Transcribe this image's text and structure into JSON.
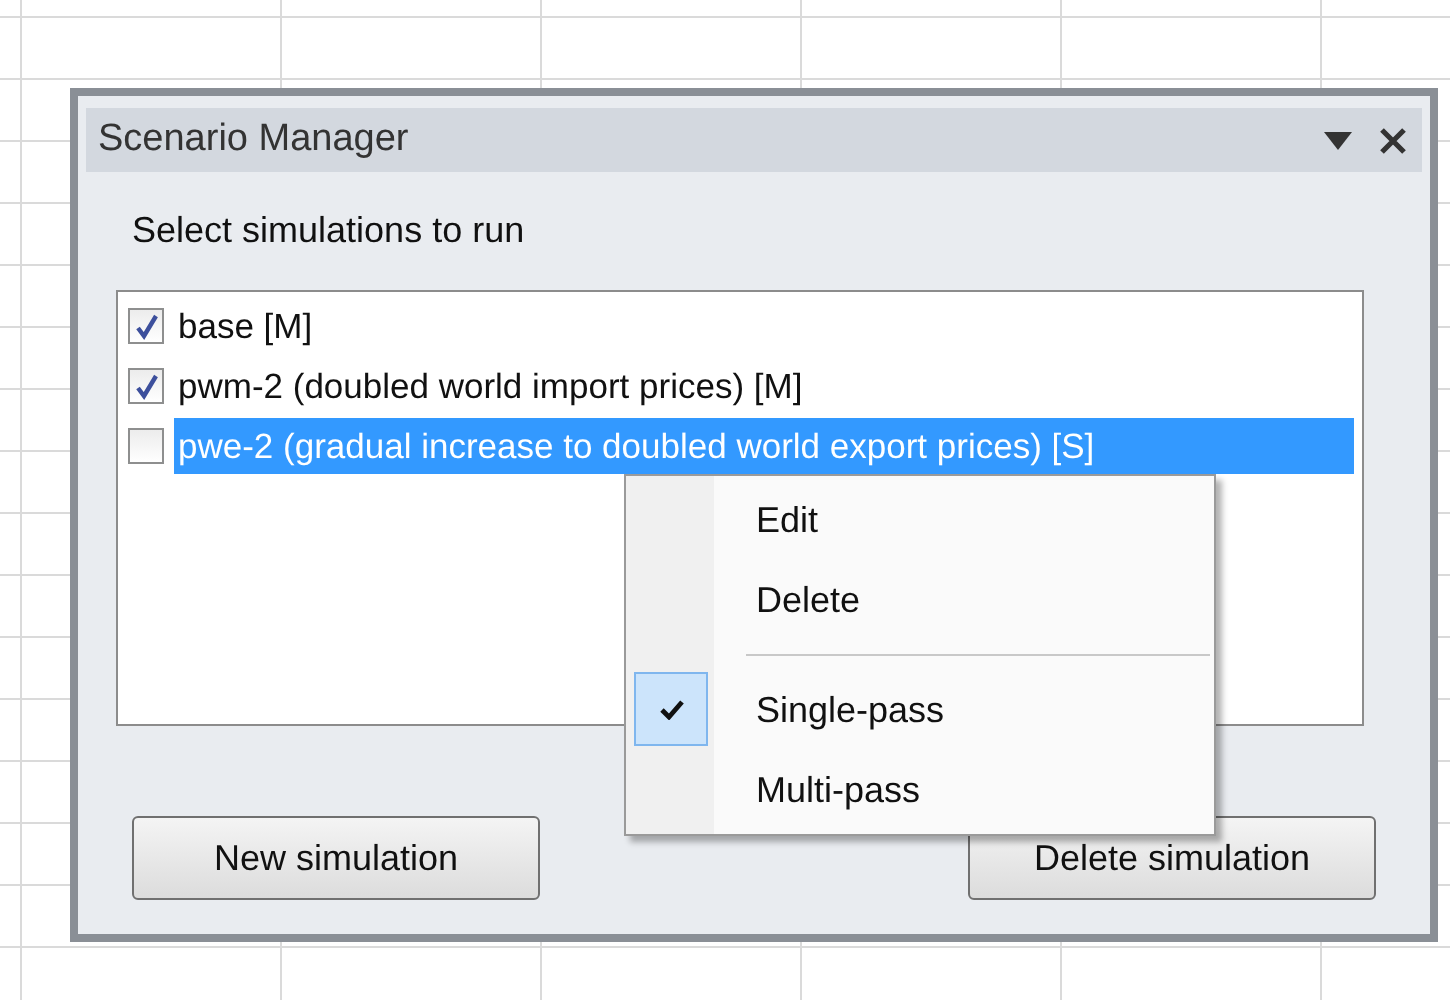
{
  "panel": {
    "title": "Scenario Manager",
    "prompt": "Select simulations to run",
    "simulations": [
      {
        "label": "base [M]",
        "checked": true,
        "selected": false
      },
      {
        "label": "pwm-2 (doubled world import prices) [M]",
        "checked": true,
        "selected": false
      },
      {
        "label": "pwe-2 (gradual increase to doubled world export prices) [S]",
        "checked": false,
        "selected": true
      }
    ],
    "buttons": [
      "New simulation",
      "Delete simulation"
    ]
  },
  "context_menu": {
    "sections": [
      [
        {
          "label": "Edit",
          "checked": false
        },
        {
          "label": "Delete",
          "checked": false
        }
      ],
      [
        {
          "label": "Single-pass",
          "checked": true
        },
        {
          "label": "Multi-pass",
          "checked": false
        }
      ]
    ]
  }
}
